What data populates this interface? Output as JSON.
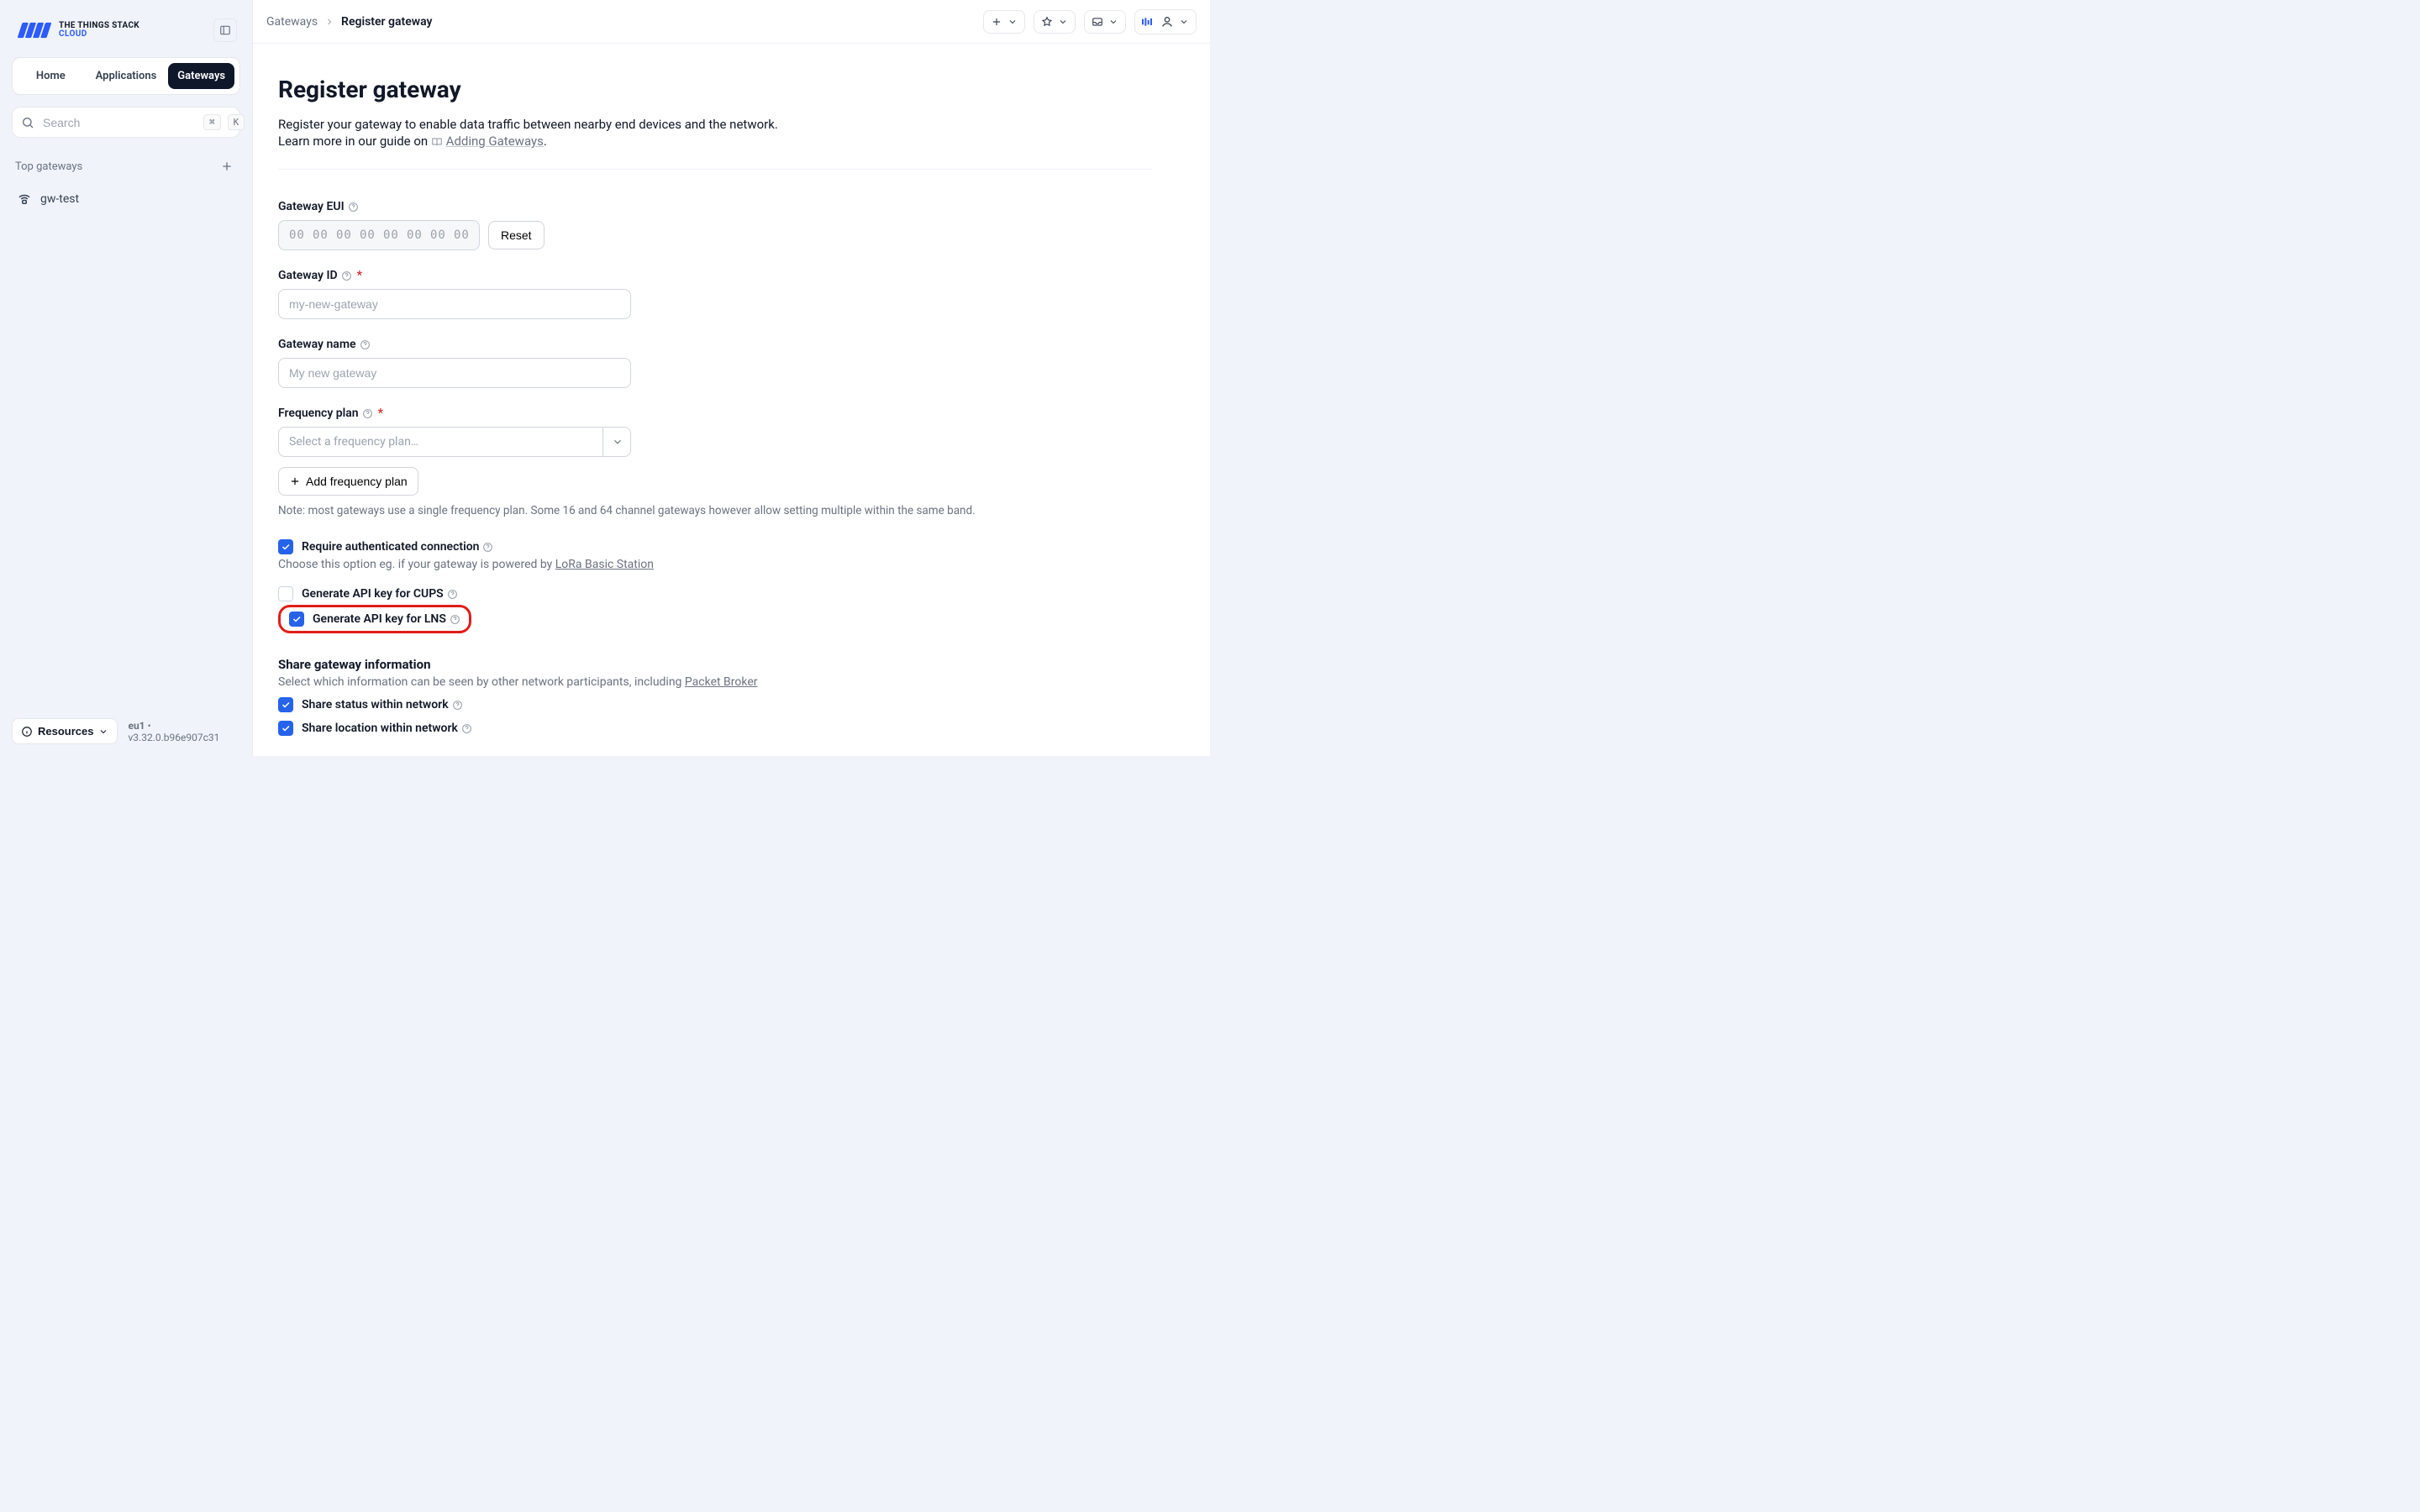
{
  "brand": {
    "line1": "THE THINGS STACK",
    "line2": "CLOUD"
  },
  "nav": {
    "tabs": [
      "Home",
      "Applications",
      "Gateways"
    ],
    "active_index": 2
  },
  "search": {
    "placeholder": "Search",
    "kbd1": "⌘",
    "kbd2": "K"
  },
  "top_gateways": {
    "title": "Top gateways",
    "items": [
      {
        "label": "gw-test"
      }
    ]
  },
  "footer": {
    "resources_label": "Resources",
    "cluster": "eu1",
    "version": "v3.32.0.b96e907c31"
  },
  "breadcrumb": {
    "parent": "Gateways",
    "current": "Register gateway"
  },
  "page": {
    "title": "Register gateway",
    "intro_part1": "Register your gateway to enable data traffic between nearby end devices and the network.",
    "intro_part2a": "Learn more in our guide on ",
    "intro_link": "Adding Gateways",
    "intro_part2b": "."
  },
  "form": {
    "eui": {
      "label": "Gateway EUI",
      "octets": [
        "00",
        "00",
        "00",
        "00",
        "00",
        "00",
        "00",
        "00"
      ],
      "reset": "Reset"
    },
    "id": {
      "label": "Gateway ID",
      "placeholder": "my-new-gateway"
    },
    "name": {
      "label": "Gateway name",
      "placeholder": "My new gateway"
    },
    "freq": {
      "label": "Frequency plan",
      "placeholder": "Select a frequency plan…",
      "add_btn": "Add frequency plan",
      "note": "Note: most gateways use a single frequency plan. Some 16 and 64 channel gateways however allow setting multiple within the same band."
    },
    "req_auth": {
      "label": "Require authenticated connection",
      "hint_prefix": "Choose this option eg. if your gateway is powered by ",
      "hint_link": "LoRa Basic Station",
      "checked": true
    },
    "cups": {
      "label": "Generate API key for CUPS",
      "checked": false
    },
    "lns": {
      "label": "Generate API key for LNS",
      "checked": true
    },
    "share": {
      "title": "Share gateway information",
      "hint_prefix": "Select which information can be seen by other network participants, including ",
      "hint_link": "Packet Broker",
      "status": {
        "label": "Share status within network",
        "checked": true
      },
      "location": {
        "label": "Share location within network",
        "checked": true
      }
    }
  }
}
